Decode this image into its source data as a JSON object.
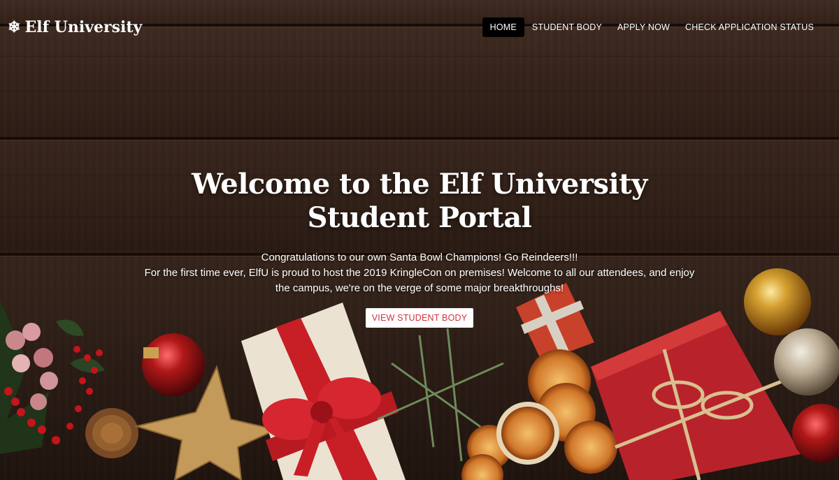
{
  "brand": {
    "icon": "snowflake-icon",
    "glyph": "❄",
    "name": "Elf University"
  },
  "nav": {
    "items": [
      {
        "label": "HOME",
        "active": true
      },
      {
        "label": "STUDENT BODY",
        "active": false
      },
      {
        "label": "APPLY NOW",
        "active": false
      },
      {
        "label": "CHECK APPLICATION STATUS",
        "active": false
      }
    ]
  },
  "hero": {
    "title": "Welcome to the Elf University Student Portal",
    "line1": "Congratulations to our own Santa Bowl Champions! Go Reindeers!!!",
    "line2": "For the first time ever, ElfU is proud to host the 2019 KringleCon on premises! Welcome to all our attendees, and enjoy the campus, we're on the verge of some major breakthroughs!",
    "cta_label": "VIEW STUDENT BODY"
  },
  "colors": {
    "active_nav_bg": "#000000",
    "cta_text": "#d0303c",
    "wood": "#3f2a1e",
    "gift_red": "#b8232b"
  }
}
